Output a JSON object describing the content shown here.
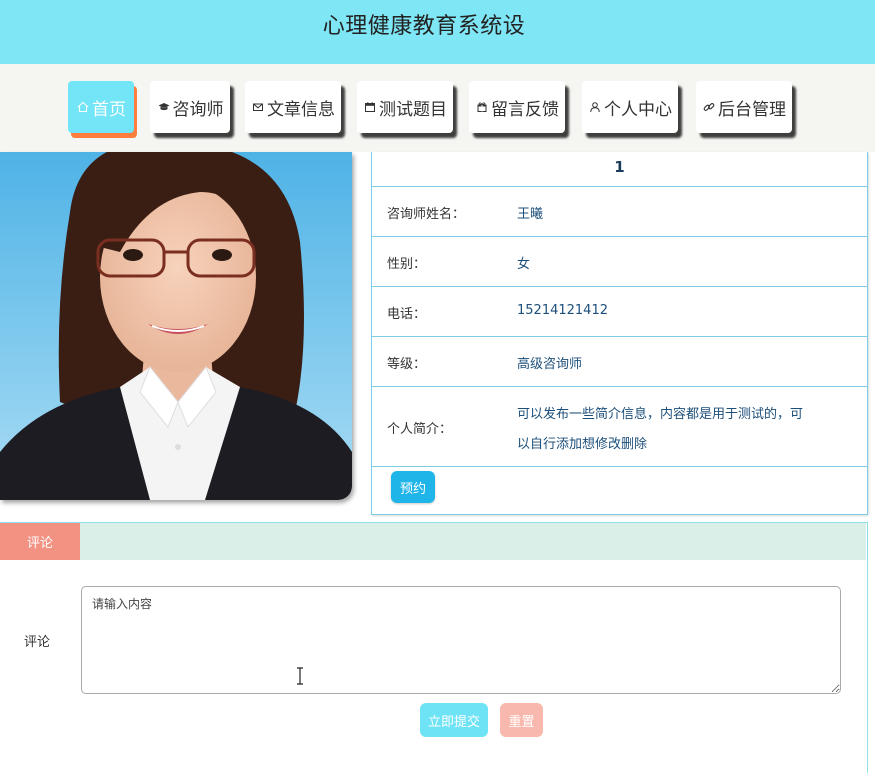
{
  "header": {
    "title": "心理健康教育系统设"
  },
  "nav": {
    "items": [
      {
        "label": "首页",
        "icon": "home-icon",
        "active": true
      },
      {
        "label": "咨询师",
        "icon": "graduation-cap-icon"
      },
      {
        "label": "文章信息",
        "icon": "envelope-icon"
      },
      {
        "label": "测试题目",
        "icon": "calendar-icon"
      },
      {
        "label": "留言反馈",
        "icon": "gift-icon"
      },
      {
        "label": "个人中心",
        "icon": "user-icon"
      },
      {
        "label": "后台管理",
        "icon": "link-icon"
      }
    ]
  },
  "counselor": {
    "index": "1",
    "name_label": "咨询师姓名：",
    "name": "王曦",
    "gender_label": "性别：",
    "gender": "女",
    "phone_label": "电话：",
    "phone": "15214121412",
    "level_label": "等级：",
    "level": "高级咨询师",
    "bio_label": "个人简介：",
    "bio_line1": "可以发布一些简介信息，内容都是用于测试的，可",
    "bio_line2": "以自行添加想修改删除",
    "book_button": "预约"
  },
  "comment": {
    "tab_label": "评论",
    "field_label": "评论",
    "placeholder": "请输入内容",
    "submit_label": "立即提交",
    "reset_label": "重置"
  },
  "colors": {
    "header_bg": "#7fe6f5",
    "nav_active": "#72e5f6",
    "nav_active_shadow": "#ff7e3e",
    "table_border": "#7ecfe6",
    "book_button": "#1fb5e8",
    "comment_tab": "#f19283",
    "comment_tabbar": "#d9efe8",
    "submit_button": "#6fe3f6",
    "reset_button": "#f9b8ae"
  }
}
